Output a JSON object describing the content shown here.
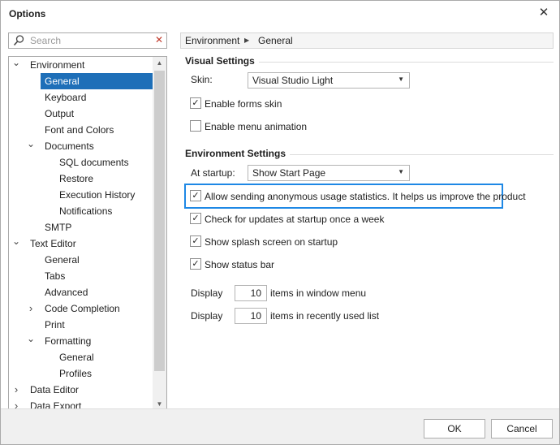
{
  "window": {
    "title": "Options",
    "close_icon": "close-icon"
  },
  "search": {
    "placeholder": "Search",
    "search_icon": "search-icon",
    "clear_icon": "clear-icon"
  },
  "tree": {
    "items": [
      {
        "label": "Environment",
        "level": 0,
        "expanded": true
      },
      {
        "label": "General",
        "level": 1,
        "selected": true
      },
      {
        "label": "Keyboard",
        "level": 1
      },
      {
        "label": "Output",
        "level": 1
      },
      {
        "label": "Font and Colors",
        "level": 1
      },
      {
        "label": "Documents",
        "level": 1,
        "expanded": true
      },
      {
        "label": "SQL documents",
        "level": 2
      },
      {
        "label": "Restore",
        "level": 2
      },
      {
        "label": "Execution History",
        "level": 2
      },
      {
        "label": "Notifications",
        "level": 2
      },
      {
        "label": "SMTP",
        "level": 1
      },
      {
        "label": "Text Editor",
        "level": 0,
        "expanded": true
      },
      {
        "label": "General",
        "level": 1
      },
      {
        "label": "Tabs",
        "level": 1
      },
      {
        "label": "Advanced",
        "level": 1
      },
      {
        "label": "Code Completion",
        "level": 1,
        "expanded": false
      },
      {
        "label": "Print",
        "level": 1
      },
      {
        "label": "Formatting",
        "level": 1,
        "expanded": true
      },
      {
        "label": "General",
        "level": 2
      },
      {
        "label": "Profiles",
        "level": 2
      },
      {
        "label": "Data Editor",
        "level": 0,
        "expanded": false
      },
      {
        "label": "Data Export",
        "level": 0,
        "expanded": false
      }
    ]
  },
  "breadcrumb": {
    "part1": "Environment",
    "part2": "General"
  },
  "visual": {
    "section_title": "Visual Settings",
    "skin_label": "Skin:",
    "skin_value": "Visual Studio Light",
    "enable_forms_skin": {
      "label": "Enable forms skin",
      "checked": true
    },
    "enable_menu_animation": {
      "label": "Enable menu animation",
      "checked": false
    }
  },
  "environment": {
    "section_title": "Environment Settings",
    "startup_label": "At startup:",
    "startup_value": "Show Start Page",
    "checkboxes": [
      {
        "label": "Allow sending anonymous usage statistics. It helps us improve the product",
        "checked": true
      },
      {
        "label": "Check for updates at startup once a week",
        "checked": true
      },
      {
        "label": "Show splash screen on startup",
        "checked": true
      },
      {
        "label": "Show status bar",
        "checked": true
      }
    ],
    "window_menu": {
      "prefix": "Display",
      "value": "10",
      "suffix": "items in window menu"
    },
    "recent_list": {
      "prefix": "Display",
      "value": "10",
      "suffix": "items in recently used list"
    }
  },
  "buttons": {
    "ok": "OK",
    "cancel": "Cancel"
  },
  "colors": {
    "accent": "#1e6fb8",
    "highlight_border": "#1e88e5"
  }
}
